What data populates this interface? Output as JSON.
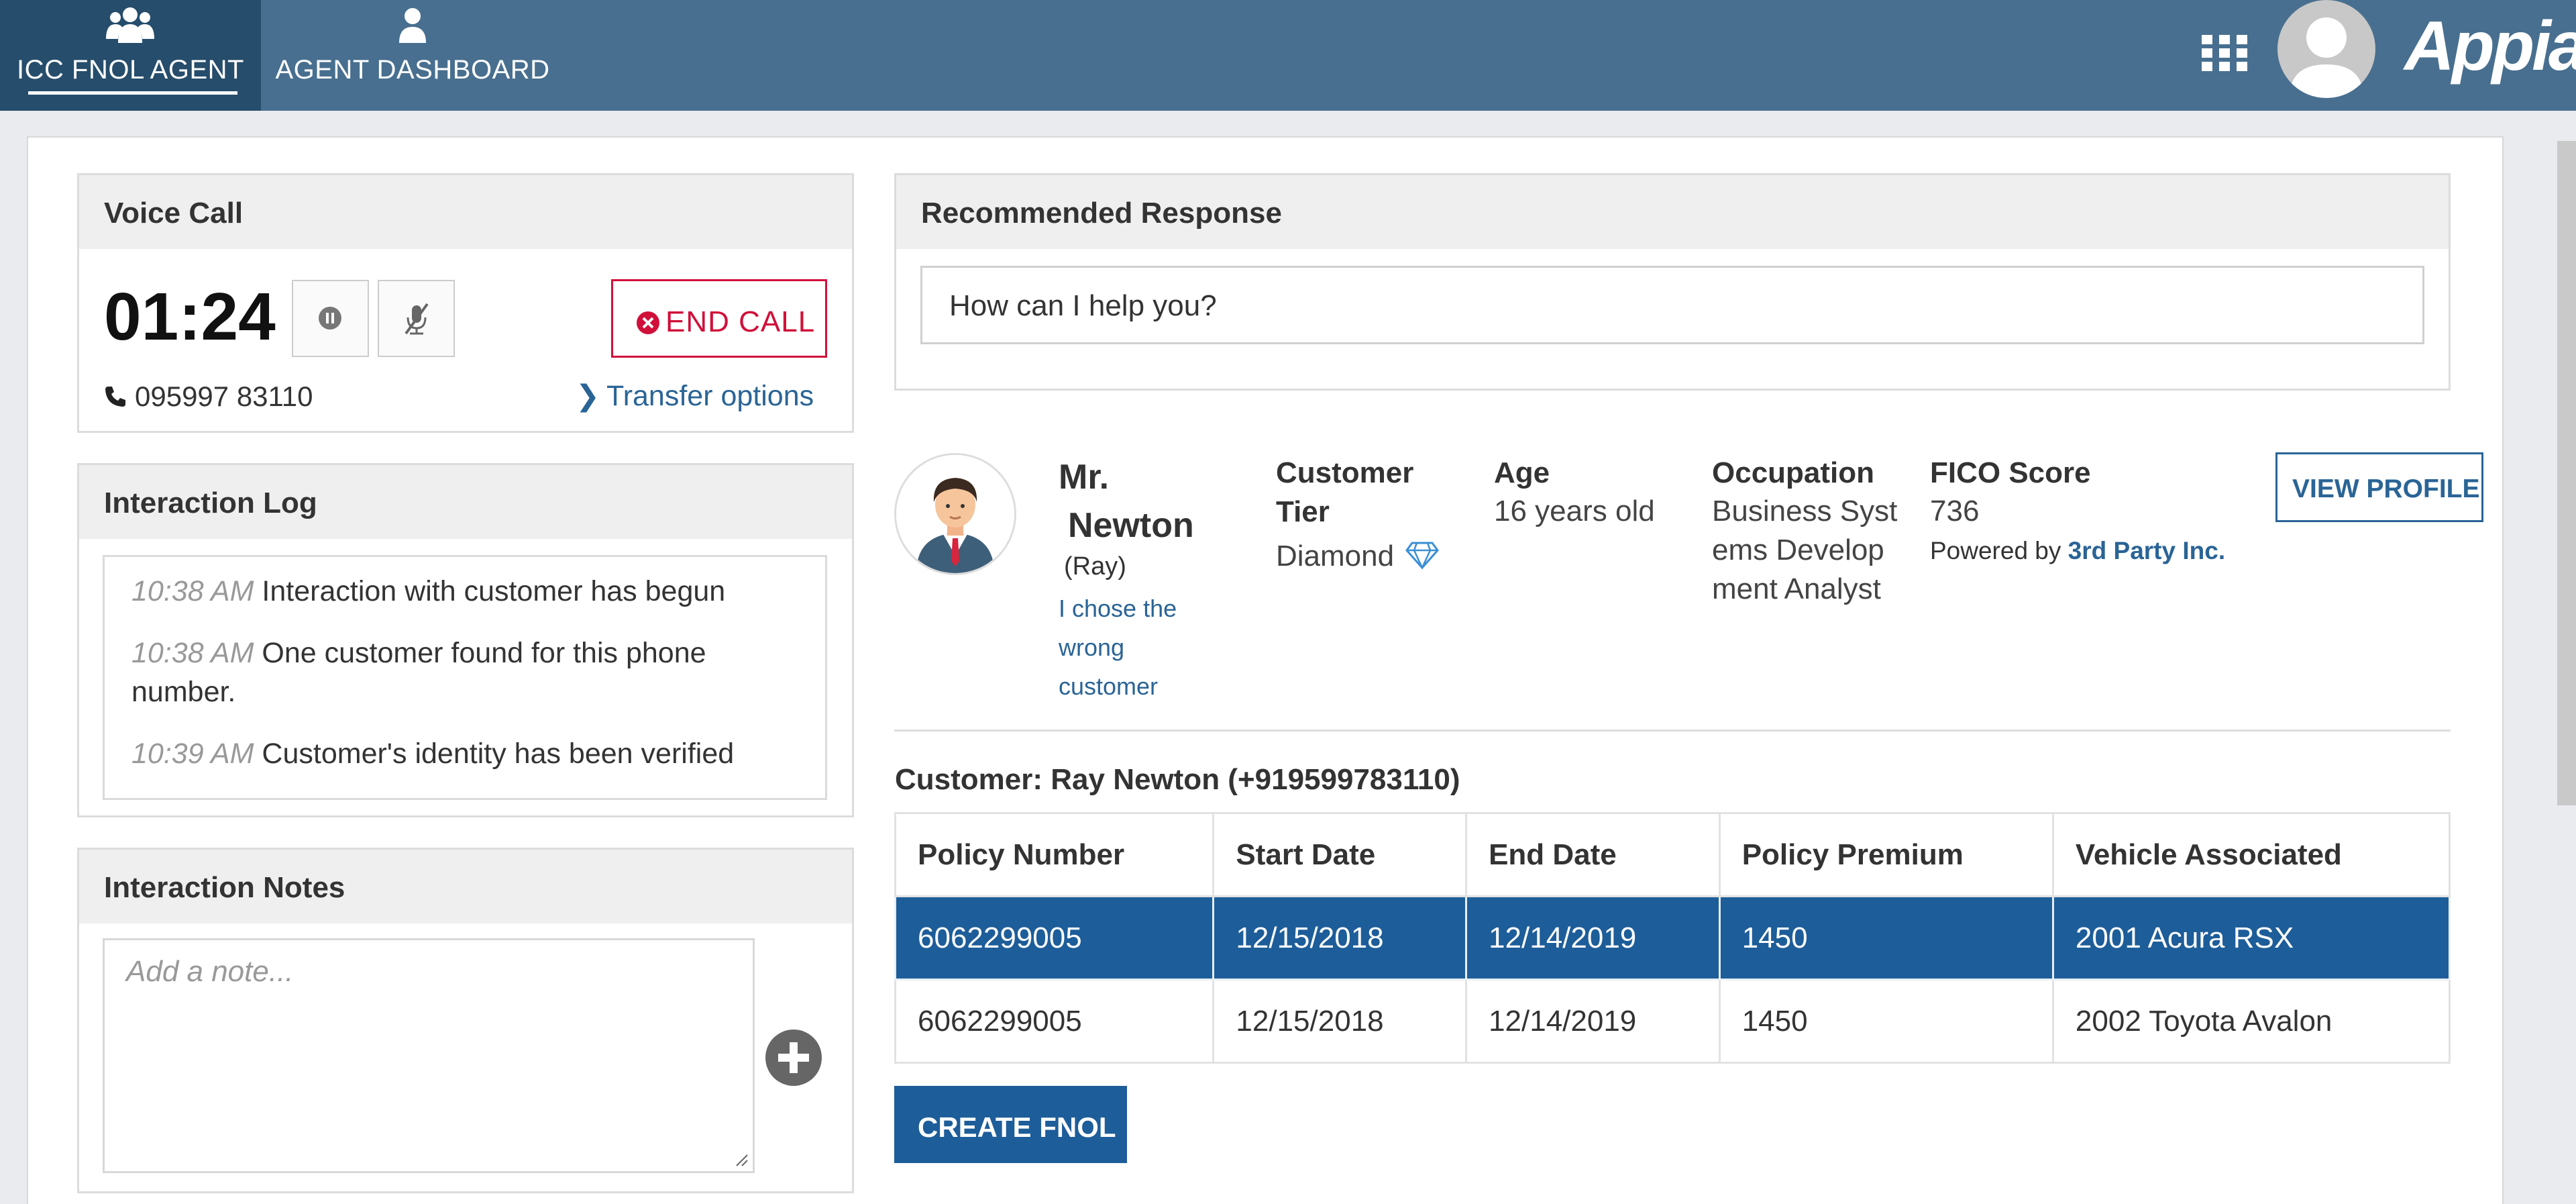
{
  "nav": {
    "tabs": [
      {
        "label": "ICC FNOL AGENT",
        "icon": "users-icon",
        "active": true
      },
      {
        "label": "AGENT DASHBOARD",
        "icon": "user-icon",
        "active": false
      }
    ],
    "brand": "Appian"
  },
  "voice_call": {
    "header": "Voice Call",
    "timer": "01:24",
    "end_call_label": "END CALL",
    "phone": "095997 83110",
    "transfer_label": "Transfer options"
  },
  "interaction_log": {
    "header": "Interaction Log",
    "entries": [
      {
        "time": "10:38 AM",
        "text": "Interaction with customer has begun"
      },
      {
        "time": "10:38 AM",
        "text": "One customer found for this phone number."
      },
      {
        "time": "10:39 AM",
        "text": "Customer's identity has been verified"
      }
    ]
  },
  "interaction_notes": {
    "header": "Interaction Notes",
    "placeholder": "Add a note..."
  },
  "recommended_response": {
    "header": "Recommended Response",
    "text": "How can I help you?"
  },
  "customer": {
    "title": "Mr.",
    "last_name": "Newton",
    "nickname": "(Ray)",
    "wrong_customer_link": "I chose the wrong customer",
    "tier_label": "Customer Tier",
    "tier_value": "Diamond",
    "age_label": "Age",
    "age_value": "16 years old",
    "occupation_label": "Occupation",
    "occupation_value": "Business Systems Development Analyst",
    "fico_label": "FICO Score",
    "fico_value": "736",
    "powered_by": "Powered by",
    "powered_by_vendor": "3rd Party Inc.",
    "view_profile_label": "VIEW PROFILE",
    "summary_line": "Customer: Ray Newton (+919599783110)"
  },
  "policies": {
    "columns": [
      "Policy Number",
      "Start Date",
      "End Date",
      "Policy Premium",
      "Vehicle Associated"
    ],
    "rows": [
      {
        "selected": true,
        "cells": [
          "6062299005",
          "12/15/2018",
          "12/14/2019",
          "1450",
          "2001 Acura RSX"
        ]
      },
      {
        "selected": false,
        "cells": [
          "6062299005",
          "12/15/2018",
          "12/14/2019",
          "1450",
          "2002 Toyota Avalon"
        ]
      }
    ]
  },
  "create_fnol_label": "CREATE FNOL",
  "colors": {
    "nav": "#486f8f",
    "nav_active": "#264d6b",
    "primary": "#1d5d99",
    "link": "#2a6496",
    "danger": "#d0103a"
  }
}
